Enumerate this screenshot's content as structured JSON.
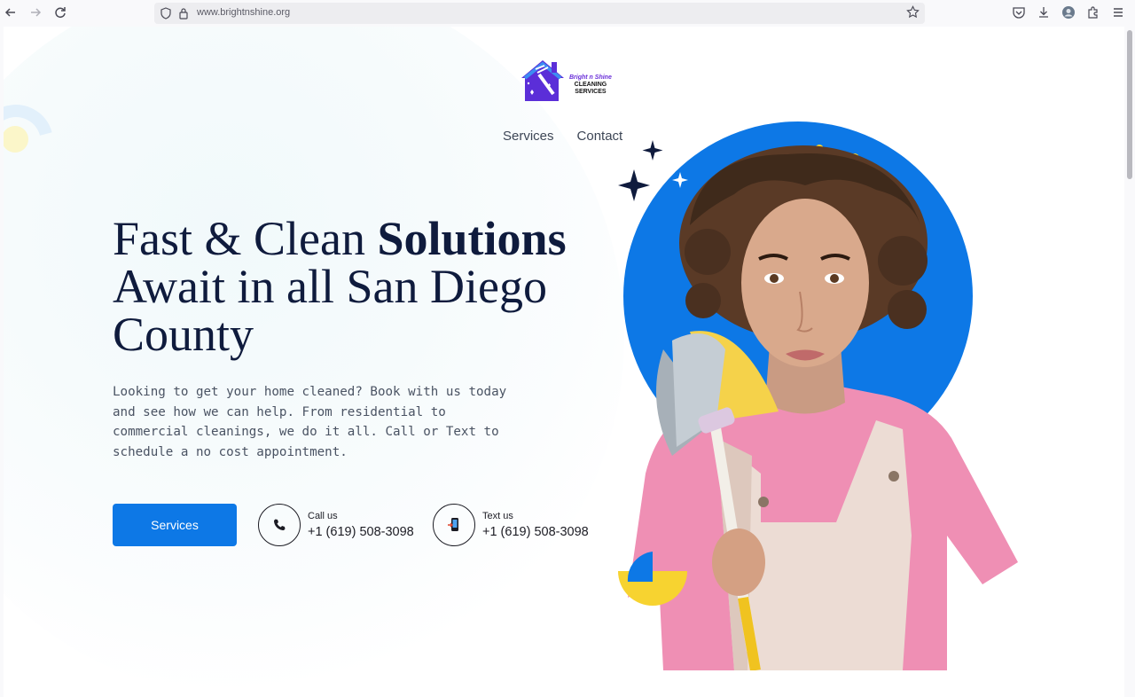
{
  "browser": {
    "url": "www.brightnshine.org"
  },
  "logo": {
    "line1": "Bright n Shine",
    "line2": "CLEANING",
    "line3": "SERVICES"
  },
  "nav": {
    "items": [
      "Services",
      "Contact"
    ]
  },
  "hero": {
    "headline_part1": "Fast & Clean ",
    "headline_bold": "Solutions",
    "headline_part2": "Await in all San Diego County",
    "lead": "Looking to get your home cleaned? Book with us today and see how we can help. From residential to commercial cleanings, we do it all. Call or Text to schedule a no cost appointment.",
    "cta_label": "Services"
  },
  "contacts": [
    {
      "label": "Call us",
      "number": "+1 (619) 508-3098",
      "icon": "phone-icon"
    },
    {
      "label": "Text us",
      "number": "+1 (619) 508-3098",
      "icon": "mobile-phone-icon"
    }
  ],
  "colors": {
    "accent": "#0d78e6",
    "heading": "#0f1b3d",
    "logo_purple": "#6a2fd9",
    "yellow": "#f7d330",
    "pink_shirt": "#ef8fb4"
  }
}
